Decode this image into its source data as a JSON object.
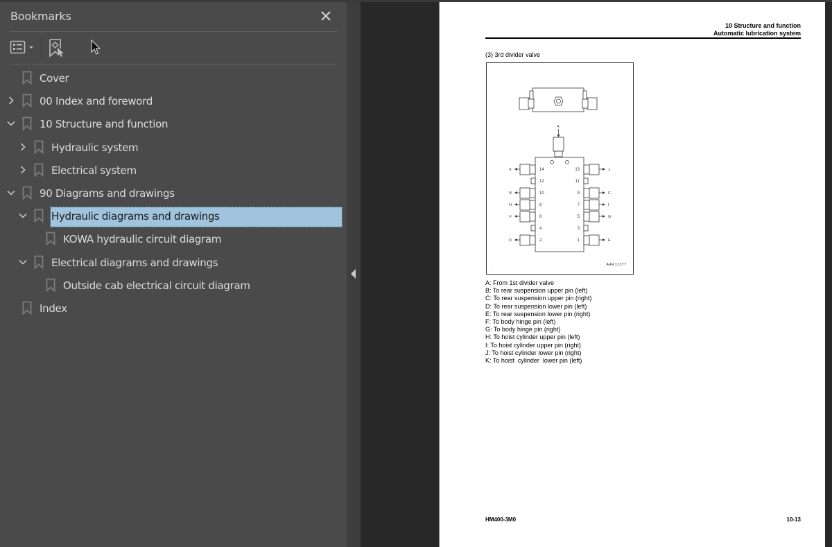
{
  "bookmarks_panel": {
    "title": "Bookmarks",
    "close_icon": "close-icon",
    "toolbar": {
      "options_icon": "list-options-icon",
      "new_bookmark_icon": "new-bookmark-icon"
    },
    "items": [
      {
        "label": "Cover",
        "level": 0,
        "expander": "none"
      },
      {
        "label": "00 Index and foreword",
        "level": 0,
        "expander": "collapsed"
      },
      {
        "label": "10 Structure and function",
        "level": 0,
        "expander": "expanded"
      },
      {
        "label": "Hydraulic system",
        "level": 1,
        "expander": "collapsed"
      },
      {
        "label": "Electrical system",
        "level": 1,
        "expander": "collapsed"
      },
      {
        "label": "90 Diagrams and drawings",
        "level": 0,
        "expander": "expanded"
      },
      {
        "label": "Hydraulic diagrams and drawings",
        "level": 1,
        "expander": "expanded",
        "selected": true
      },
      {
        "label": "KOWA hydraulic circuit diagram",
        "level": 2,
        "expander": "none"
      },
      {
        "label": "Electrical diagrams and drawings",
        "level": 1,
        "expander": "expanded"
      },
      {
        "label": "Outside cab electrical circuit diagram",
        "level": 2,
        "expander": "none"
      },
      {
        "label": "Index",
        "level": 0,
        "expander": "none"
      }
    ],
    "selection_color": "#a0c4de"
  },
  "splitter": {
    "collapse_icon": "triangle-left-icon"
  },
  "document": {
    "header_line1": "10 Structure and function",
    "header_line2": "Automatic lubrication system",
    "subtitle": "(3) 3rd divider valve",
    "figure": {
      "code": "A4R11377",
      "inlet_label": "A",
      "left_ports": [
        {
          "num": "14",
          "label": "K"
        },
        {
          "num": "12",
          "label": ""
        },
        {
          "num": "10",
          "label": "B"
        },
        {
          "num": "8",
          "label": "H"
        },
        {
          "num": "6",
          "label": "F"
        },
        {
          "num": "4",
          "label": ""
        },
        {
          "num": "2",
          "label": "D"
        }
      ],
      "right_ports": [
        {
          "num": "13",
          "label": "J"
        },
        {
          "num": "11",
          "label": ""
        },
        {
          "num": "9",
          "label": "C"
        },
        {
          "num": "7",
          "label": "I"
        },
        {
          "num": "5",
          "label": "G"
        },
        {
          "num": "3",
          "label": ""
        },
        {
          "num": "1",
          "label": "E"
        }
      ]
    },
    "legend": [
      "A: From 1st divider valve",
      "B: To rear suspension upper pin (left)",
      "C: To rear suspension upper pin (right)",
      "D: To rear suspension lower pin (left)",
      "E: To rear suspension lower pin (right)",
      "F: To body hinge pin (left)",
      "G: To body hinge pin (right)",
      "H: To hoist cylinder upper pin (left)",
      "I: To hoist cylinder upper pin (right)",
      "J: To hoist cylinder lower pin (right)",
      "K: To hoist  cylinder  lower pin (left)"
    ],
    "footer_model": "HM400-3M0",
    "footer_page": "10-13"
  }
}
